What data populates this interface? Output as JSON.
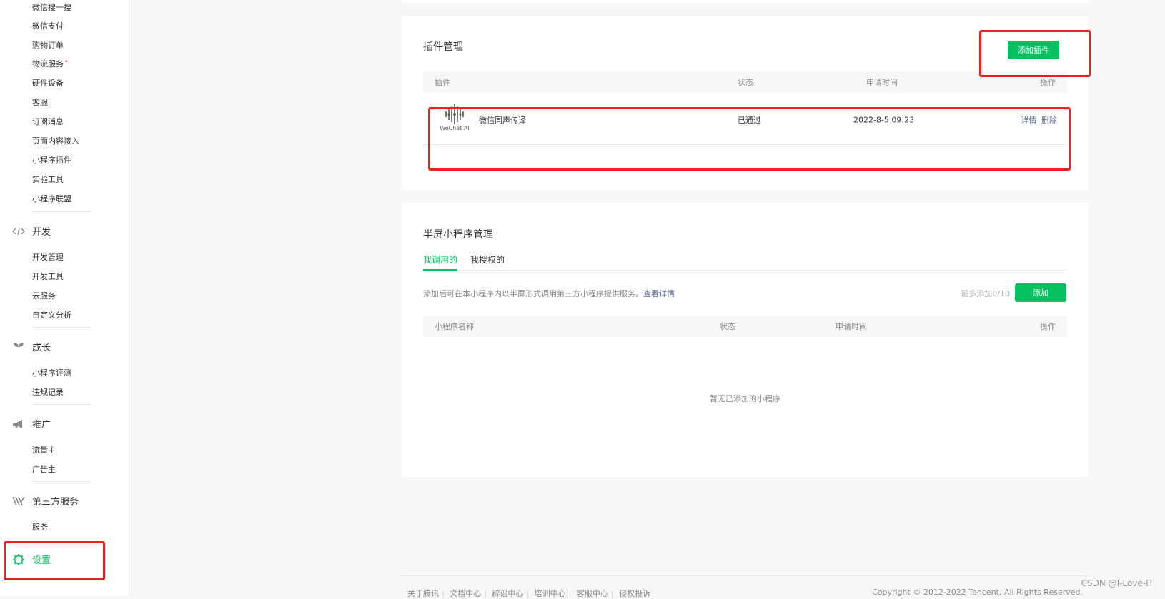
{
  "sidebar": {
    "top_items": [
      {
        "label": "微信搜一搜",
        "badge": ""
      },
      {
        "label": "微信支付",
        "badge": ""
      },
      {
        "label": "购物订单",
        "badge": ""
      },
      {
        "label": "物流服务",
        "badge": "•"
      },
      {
        "label": "硬件设备",
        "badge": ""
      },
      {
        "label": "客服",
        "badge": ""
      },
      {
        "label": "订阅消息",
        "badge": ""
      },
      {
        "label": "页面内容接入",
        "badge": ""
      },
      {
        "label": "小程序插件",
        "badge": ""
      },
      {
        "label": "实验工具",
        "badge": ""
      },
      {
        "label": "小程序联盟",
        "badge": ""
      }
    ],
    "dev": {
      "label": "开发",
      "items": [
        "开发管理",
        "开发工具",
        "云服务",
        "自定义分析"
      ]
    },
    "grow": {
      "label": "成长",
      "items": [
        "小程序评测",
        "违规记录"
      ]
    },
    "promo": {
      "label": "推广",
      "items": [
        "流量主",
        "广告主"
      ]
    },
    "third": {
      "label": "第三方服务",
      "items": [
        "服务"
      ]
    },
    "settings": {
      "label": "设置"
    }
  },
  "plugin": {
    "title": "插件管理",
    "add_button": "添加插件",
    "columns": [
      "插件",
      "状态",
      "申请时间",
      "操作"
    ],
    "rows": [
      {
        "logo_text": "WeChat AI",
        "name": "微信同声传译",
        "status": "已通过",
        "time": "2022-8-5 09:23",
        "action_detail": "详情",
        "action_delete": "删除"
      }
    ]
  },
  "halfscreen": {
    "title": "半屏小程序管理",
    "tabs": [
      "我调用的",
      "我授权的"
    ],
    "desc": "添加后可在本小程序内以半屏形式调用第三方小程序提供服务。",
    "desc_link": "查看详情",
    "limit": "最多添加0/10",
    "add_button": "添加",
    "columns": [
      "小程序名称",
      "状态",
      "申请时间",
      "操作"
    ],
    "empty": "暂无已添加的小程序"
  },
  "footer": {
    "links": [
      "关于腾讯",
      "文档中心",
      "辟谣中心",
      "培训中心",
      "客服中心",
      "侵权投诉"
    ],
    "copyright": "Copyright © 2012-2022 Tencent. All Rights Reserved."
  },
  "watermark": "CSDN @I-Love-IT",
  "colors": {
    "brand": "#07c160",
    "highlight": "#f02020",
    "link": "#576b95"
  }
}
